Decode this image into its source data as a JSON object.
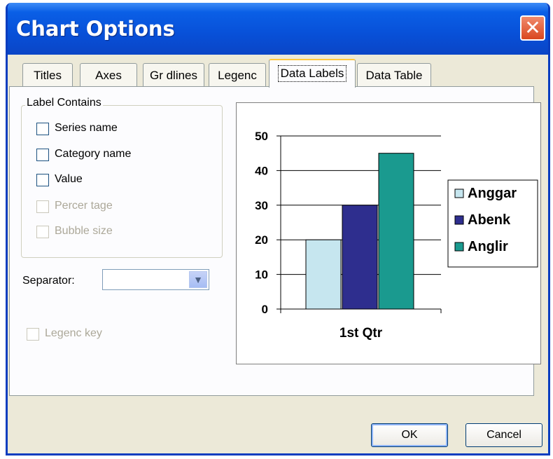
{
  "window": {
    "title": "Chart Options",
    "close_icon": "close-icon"
  },
  "tabs": [
    {
      "label": "Titles"
    },
    {
      "label": "Axes"
    },
    {
      "label": "Gr dlines"
    },
    {
      "label": "Legenc"
    },
    {
      "label": "Data Labels",
      "active": true
    },
    {
      "label": "Data Table"
    }
  ],
  "label_contains": {
    "heading": "Label Contains",
    "options": [
      {
        "label": "Series name",
        "checked": false,
        "enabled": true
      },
      {
        "label": "Category name",
        "checked": false,
        "enabled": true
      },
      {
        "label": "Value",
        "checked": false,
        "enabled": true
      },
      {
        "label": "Percer tage",
        "checked": false,
        "enabled": false
      },
      {
        "label": "Bubble size",
        "checked": false,
        "enabled": false
      }
    ]
  },
  "separator": {
    "label": "Separator:",
    "value": ""
  },
  "legend_key": {
    "label": "Legenc key",
    "checked": false,
    "enabled": false
  },
  "buttons": {
    "ok": "OK",
    "cancel": "Cancel"
  },
  "chart_data": {
    "type": "bar",
    "categories": [
      "1st Qtr"
    ],
    "series": [
      {
        "name": "Anggar",
        "values": [
          20
        ],
        "color": "#c6e6ef"
      },
      {
        "name": "Abenk",
        "values": [
          30
        ],
        "color": "#2e2e8e"
      },
      {
        "name": "Anglir",
        "values": [
          45
        ],
        "color": "#1a9a8f"
      }
    ],
    "ylim": [
      0,
      50
    ],
    "yticks": [
      0,
      10,
      20,
      30,
      40,
      50
    ],
    "grid": true,
    "legend": "right"
  }
}
